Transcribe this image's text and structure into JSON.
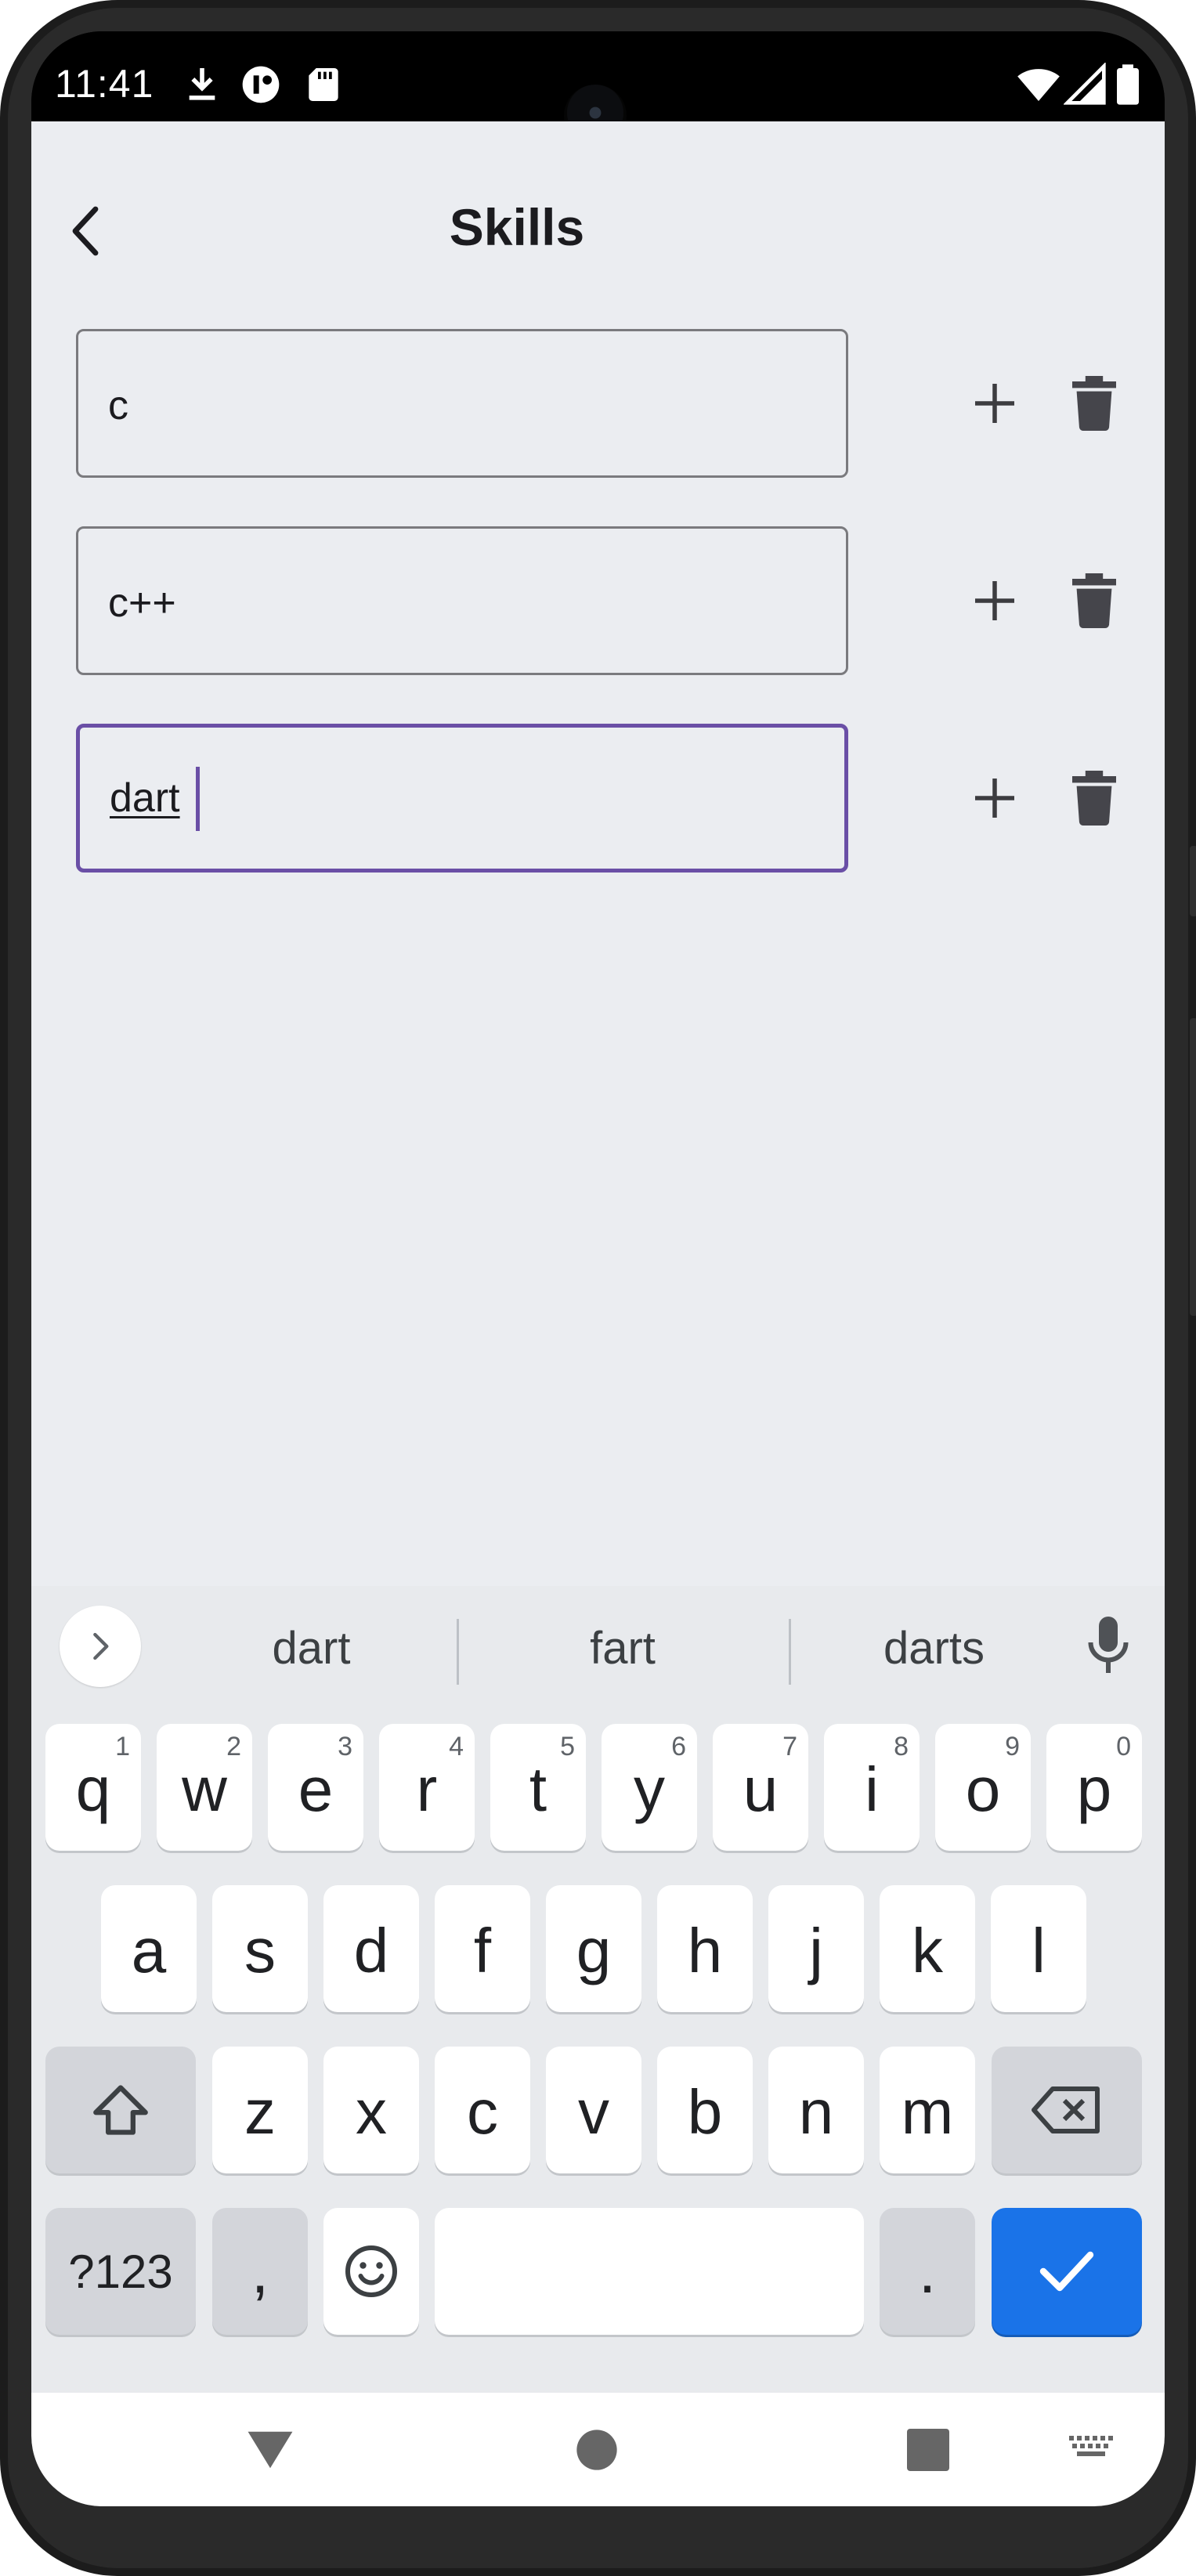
{
  "status_bar": {
    "time": "11:41",
    "left_icons": [
      "download-icon",
      "notification-app-icon",
      "sd-card-icon"
    ],
    "right_icons": [
      "wifi-icon",
      "cell-signal-icon",
      "battery-icon"
    ]
  },
  "app_bar": {
    "back_icon": "chevron-left-icon",
    "title": "Skills"
  },
  "skills": [
    {
      "value": "c",
      "focused": false
    },
    {
      "value": "c++",
      "focused": false
    },
    {
      "value": "dart",
      "focused": true
    }
  ],
  "row_actions": {
    "add_icon": "plus-icon",
    "delete_icon": "trash-icon"
  },
  "keyboard": {
    "suggestions": [
      "dart",
      "fart",
      "darts"
    ],
    "row1": [
      {
        "k": "q",
        "h": "1"
      },
      {
        "k": "w",
        "h": "2"
      },
      {
        "k": "e",
        "h": "3"
      },
      {
        "k": "r",
        "h": "4"
      },
      {
        "k": "t",
        "h": "5"
      },
      {
        "k": "y",
        "h": "6"
      },
      {
        "k": "u",
        "h": "7"
      },
      {
        "k": "i",
        "h": "8"
      },
      {
        "k": "o",
        "h": "9"
      },
      {
        "k": "p",
        "h": "0"
      }
    ],
    "row2": [
      "a",
      "s",
      "d",
      "f",
      "g",
      "h",
      "j",
      "k",
      "l"
    ],
    "row3": [
      "z",
      "x",
      "c",
      "v",
      "b",
      "n",
      "m"
    ],
    "symbols_label": "?123",
    "comma_label": ",",
    "period_label": ".",
    "colors": {
      "action_key": "#1a73e8",
      "focus_border": "#6a4fa6"
    }
  },
  "nav_bar": {
    "icons": [
      "back-triangle-icon",
      "home-circle-icon",
      "recents-square-icon",
      "keyboard-switch-icon"
    ]
  }
}
